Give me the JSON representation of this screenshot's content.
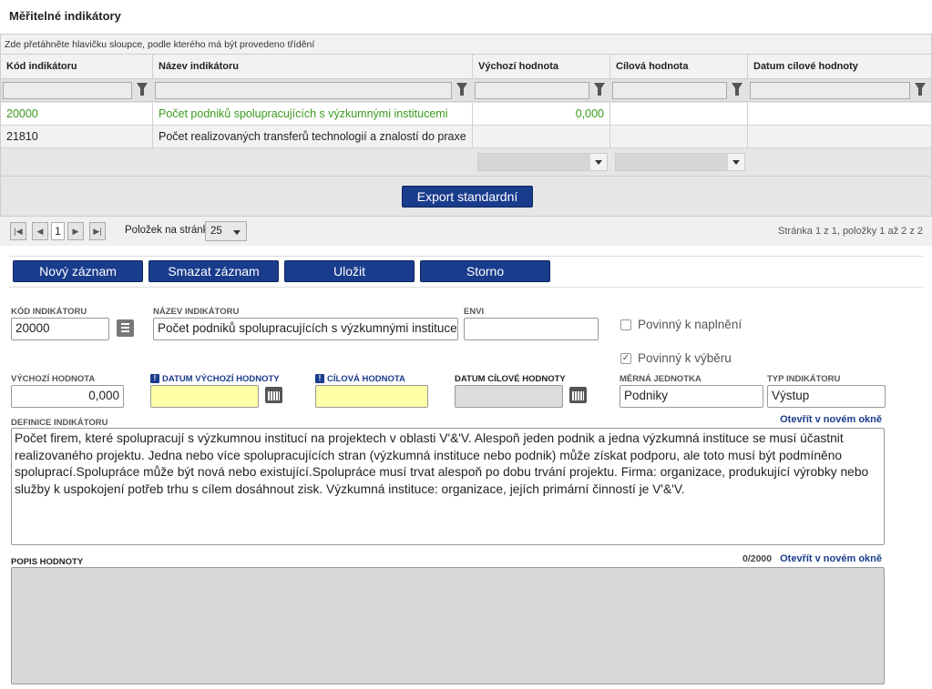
{
  "title": "Měřitelné indikátory",
  "grid": {
    "group_hint": "Zde přetáhněte hlavičku sloupce, podle kterého má být provedeno třídění",
    "columns": [
      "Kód indikátoru",
      "Název indikátoru",
      "Výchozí hodnota",
      "Cílová hodnota",
      "Datum cílové hodnoty"
    ],
    "rows": [
      {
        "code": "20000",
        "name": "Počet podniků spolupracujících s výzkumnými institucemi",
        "base": "0,000",
        "target": "",
        "date": ""
      },
      {
        "code": "21810",
        "name": "Počet realizovaných transferů technologií a znalostí do praxe",
        "base": "",
        "target": "",
        "date": ""
      }
    ],
    "export_label": "Export standardní"
  },
  "pager": {
    "current_page": "1",
    "per_page_label": "Položek na stránku",
    "per_page_value": "25",
    "summary": "Stránka 1 z 1, položky 1 až 2 z 2"
  },
  "toolbar": {
    "new": "Nový záznam",
    "delete": "Smazat záznam",
    "save": "Uložit",
    "cancel": "Storno"
  },
  "form": {
    "code_label": "Kód indikátoru",
    "code_value": "20000",
    "name_label": "Název indikátoru",
    "name_value": "Počet podniků spolupracujících s výzkumnými institucemi",
    "envi_label": "ENVI",
    "envi_value": "",
    "required_fill_label": "Povinný k naplnění",
    "required_fill_checked": false,
    "required_select_label": "Povinný k výběru",
    "required_select_checked": true,
    "base_label": "Výchozí hodnota",
    "base_value": "0,000",
    "base_date_label": "Datum výchozí hodnoty",
    "base_date_value": "",
    "target_label": "Cílová hodnota",
    "target_value": "",
    "target_date_label": "Datum cílové hodnoty",
    "target_date_value": "",
    "unit_label": "Měrná jednotka",
    "unit_value": "Podniky",
    "type_label": "Typ indikátoru",
    "type_value": "Výstup",
    "definition_label": "Definice indikátoru",
    "open_new_window": "Otevřít v novém okně",
    "definition_text": "Počet firem, které spolupracují s výzkumnou institucí na projektech v oblasti V'&'V. Alespoň jeden podnik a jedna výzkumná instituce se musí účastnit realizovaného projektu. Jedna nebo více spolupracujících stran (výzkumná instituce nebo podnik) může získat podporu, ale toto musí být podmíněno spoluprací.Spolupráce může být nová nebo existující.Spolupráce musí trvat alespoň po dobu trvání projektu. Firma: organizace, produkující výrobky nebo služby k uspokojení potřeb trhu s cílem dosáhnout zisk. Výzkumná instituce: organizace, jejích primární činností je V'&'V.",
    "desc_label": "Popis hodnoty",
    "desc_counter": "0/2000",
    "desc_text": ""
  },
  "colors": {
    "accent": "#1a3c8c",
    "highlight_text": "#3a9a1c",
    "required_field": "#ffffa8"
  }
}
